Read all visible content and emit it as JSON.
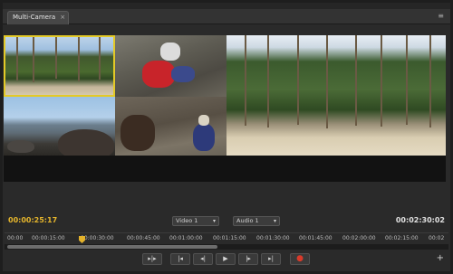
{
  "panel": {
    "tab_label": "Multi-Camera",
    "close_glyph": "×",
    "menu_glyph": "≡"
  },
  "viewer": {
    "active_angle_color": "#e3c927"
  },
  "timecode": {
    "current": "00:00:25:17",
    "duration": "00:02:30:02"
  },
  "dropdowns": {
    "video": "Video 1",
    "audio": "Audio 1",
    "arrow": "▾"
  },
  "ruler": {
    "labels": [
      "00:00",
      "00:00:15:00",
      "00:00:30:00",
      "00:00:45:00",
      "00:01:00:00",
      "00:01:15:00",
      "00:01:30:00",
      "00:01:45:00",
      "00:02:00:00",
      "00:02:15:00",
      "00:02"
    ]
  },
  "transport": {
    "shuttle": "▸|▸",
    "go_to_in": "|◂",
    "step_back": "◂|",
    "play": "▶",
    "step_forward": "|▸",
    "go_to_out": "▸|",
    "record": "●"
  },
  "add_button": "+",
  "colors": {
    "timecode_current": "#e6b62c",
    "record": "#d83a2a",
    "playhead": "#e3b22b"
  }
}
